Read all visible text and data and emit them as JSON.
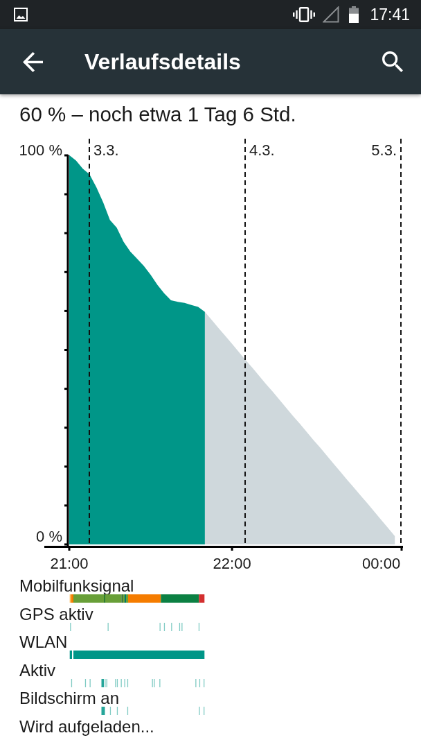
{
  "status_bar": {
    "time": "17:41"
  },
  "app_bar": {
    "title": "Verlaufsdetails"
  },
  "summary": "60 % – noch etwa 1 Tag 6 Std.",
  "chart": {
    "chart_data": {
      "type": "area",
      "categories": [
        "21:00",
        null,
        null,
        null,
        null,
        null,
        null,
        null,
        null,
        null,
        null,
        null,
        null,
        null,
        null,
        null,
        null,
        null,
        null,
        null,
        null,
        null,
        null,
        null,
        "22:00",
        null,
        null,
        null,
        null,
        null,
        null,
        null,
        null,
        null,
        null,
        null,
        null,
        null,
        null,
        null,
        null,
        null,
        null,
        null,
        null,
        null,
        "00:00",
        null,
        null,
        null
      ],
      "series": [
        {
          "color": "#009688",
          "values": [
            98.7,
            97.3,
            95.2,
            93.7,
            90.4,
            86.5,
            81.9,
            79.9,
            76.3,
            73.7,
            71.9,
            70.0,
            67.7,
            65.1,
            62.9,
            61.1,
            60.7,
            60.4,
            59.9,
            59.4,
            58.1,
            null,
            null,
            null,
            null,
            null,
            null,
            null,
            null,
            null,
            null,
            null,
            null,
            null,
            null,
            null,
            null,
            null,
            null,
            null,
            null,
            null,
            null,
            null,
            null,
            null,
            null,
            null,
            null,
            null
          ]
        },
        {
          "color": "#cfd8dc",
          "values": [
            null,
            null,
            null,
            null,
            null,
            null,
            null,
            null,
            null,
            null,
            null,
            null,
            null,
            null,
            null,
            null,
            null,
            null,
            null,
            null,
            58.1,
            56.0,
            53.9,
            51.9,
            49.8,
            47.7,
            45.6,
            43.6,
            41.5,
            39.4,
            37.4,
            35.3,
            33.2,
            31.1,
            29.1,
            27.0,
            24.9,
            22.9,
            20.8,
            18.7,
            16.6,
            14.5,
            12.5,
            10.4,
            8.4,
            6.3,
            4.2,
            2.1,
            0,
            null
          ]
        }
      ],
      "ylim": [
        0,
        100
      ],
      "yticks": [
        {
          "value": 0,
          "label": "0 %"
        },
        {
          "value": 100,
          "label": "100 %"
        }
      ],
      "grid": true,
      "annotations": [
        "3.3.",
        "4.3.",
        "5.3."
      ]
    }
  },
  "tracks": [
    {
      "label": "Mobilfunksignal"
    },
    {
      "label": "GPS aktiv"
    },
    {
      "label": "WLAN"
    },
    {
      "label": "Aktiv"
    },
    {
      "label": "Bildschirm an"
    },
    {
      "label": "Wird aufgeladen..."
    }
  ]
}
